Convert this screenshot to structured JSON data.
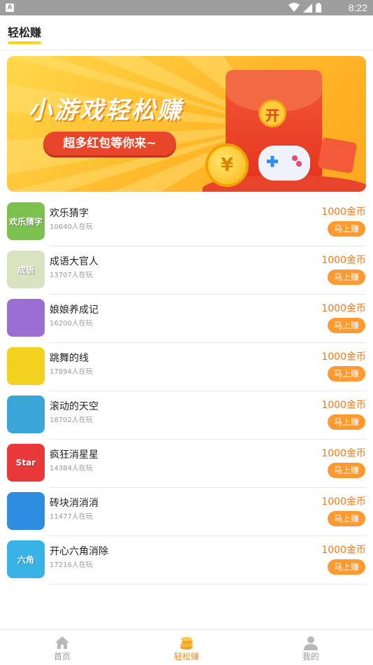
{
  "status_bar": {
    "time": "8:22"
  },
  "header": {
    "title": "轻松赚"
  },
  "banner": {
    "title": "小游戏轻松赚",
    "subtitle": "超多红包等你来~",
    "envelope_label": "开",
    "coin_symbol": "¥"
  },
  "games": [
    {
      "name": "欢乐猜字",
      "players": "10640人在玩",
      "reward": "1000金币",
      "action": "马上赚",
      "icon_text": "欢乐猜字",
      "icon_color": "#7cc14f"
    },
    {
      "name": "成语大官人",
      "players": "13707人在玩",
      "reward": "1000金币",
      "action": "马上赚",
      "icon_text": "成语",
      "icon_color": "#d9e3c2"
    },
    {
      "name": "娘娘养成记",
      "players": "16200人在玩",
      "reward": "1000金币",
      "action": "马上赚",
      "icon_text": "",
      "icon_color": "#9b6fd1"
    },
    {
      "name": "跳舞的线",
      "players": "17894人在玩",
      "reward": "1000金币",
      "action": "马上赚",
      "icon_text": "",
      "icon_color": "#f2d21e"
    },
    {
      "name": "滚动的天空",
      "players": "18702人在玩",
      "reward": "1000金币",
      "action": "马上赚",
      "icon_text": "",
      "icon_color": "#3aa7d8"
    },
    {
      "name": "疯狂消星星",
      "players": "14384人在玩",
      "reward": "1000金币",
      "action": "马上赚",
      "icon_text": "Star",
      "icon_color": "#e8383a"
    },
    {
      "name": "砖块消消消",
      "players": "11477人在玩",
      "reward": "1000金币",
      "action": "马上赚",
      "icon_text": "",
      "icon_color": "#2f8de0"
    },
    {
      "name": "开心六角消除",
      "players": "17216人在玩",
      "reward": "1000金币",
      "action": "马上赚",
      "icon_text": "六角",
      "icon_color": "#39b3e6"
    }
  ],
  "tabbar": {
    "tabs": [
      {
        "label": "首页",
        "icon": "home-icon",
        "active": false
      },
      {
        "label": "轻松赚",
        "icon": "coins-icon",
        "active": true
      },
      {
        "label": "我的",
        "icon": "user-icon",
        "active": false
      }
    ],
    "active_color": "#f08d17",
    "inactive_color": "#999999"
  },
  "colors": {
    "accent_orange": "#ff9a30",
    "reward_text": "#f07a16",
    "header_underline": "#ffd21f"
  }
}
